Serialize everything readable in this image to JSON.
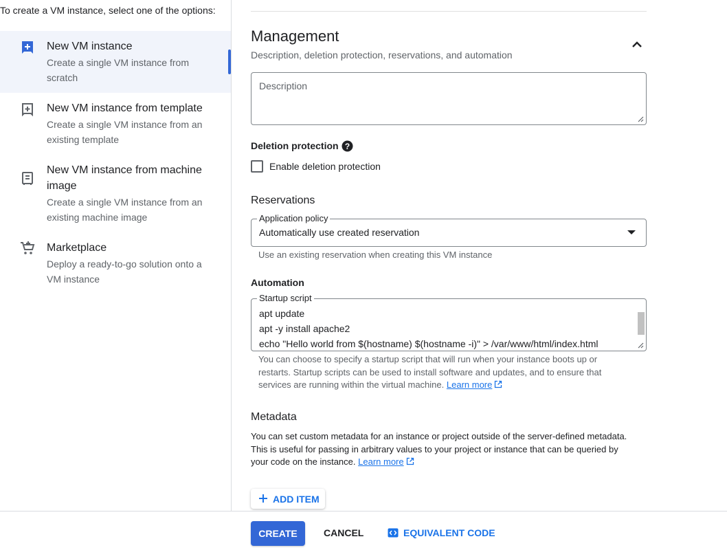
{
  "left": {
    "intro": "To create a VM instance, select one of the options:",
    "options": [
      {
        "title": "New VM instance",
        "desc": "Create a single VM instance from scratch"
      },
      {
        "title": "New VM instance from template",
        "desc": "Create a single VM instance from an existing template"
      },
      {
        "title": "New VM instance from machine image",
        "desc": "Create a single VM instance from an existing machine image"
      },
      {
        "title": "Marketplace",
        "desc": "Deploy a ready-to-go solution onto a VM instance"
      }
    ]
  },
  "management": {
    "title": "Management",
    "subtitle": "Description, deletion protection, reservations, and automation",
    "description_placeholder": "Description",
    "deletion_protection": {
      "label": "Deletion protection",
      "checkbox_label": "Enable deletion protection",
      "checked": false
    },
    "reservations": {
      "title": "Reservations",
      "policy_label": "Application policy",
      "policy_value": "Automatically use created reservation",
      "hint": "Use an existing reservation when creating this VM instance"
    },
    "automation": {
      "title": "Automation",
      "script_label": "Startup script",
      "script_lines": [
        "apt update",
        "apt -y install apache2",
        "echo \"Hello world from $(hostname) $(hostname -i)\" > /var/www/html/index.html"
      ],
      "hint_line1": "You can choose to specify a startup script that will run when your instance boots up or",
      "hint_line2": "restarts. Startup scripts can be used to install software and updates, and to ensure that",
      "hint_line3": "services are running within the virtual machine.",
      "learn_more": "Learn more"
    },
    "metadata": {
      "title": "Metadata",
      "desc_line1": "You can set custom metadata for an instance or project outside of the server-defined metadata.",
      "desc_line2": "This is useful for passing in arbitrary values to your project or instance that can be queried by",
      "desc_line3": "your code on the instance.",
      "learn_more": "Learn more",
      "add_item": "ADD ITEM"
    }
  },
  "footer": {
    "create": "CREATE",
    "cancel": "CANCEL",
    "equivalent_code": "EQUIVALENT CODE"
  },
  "colors": {
    "accent": "#1a73e8",
    "primary_button": "#3367d6",
    "selected_bg": "#f1f4fb"
  }
}
